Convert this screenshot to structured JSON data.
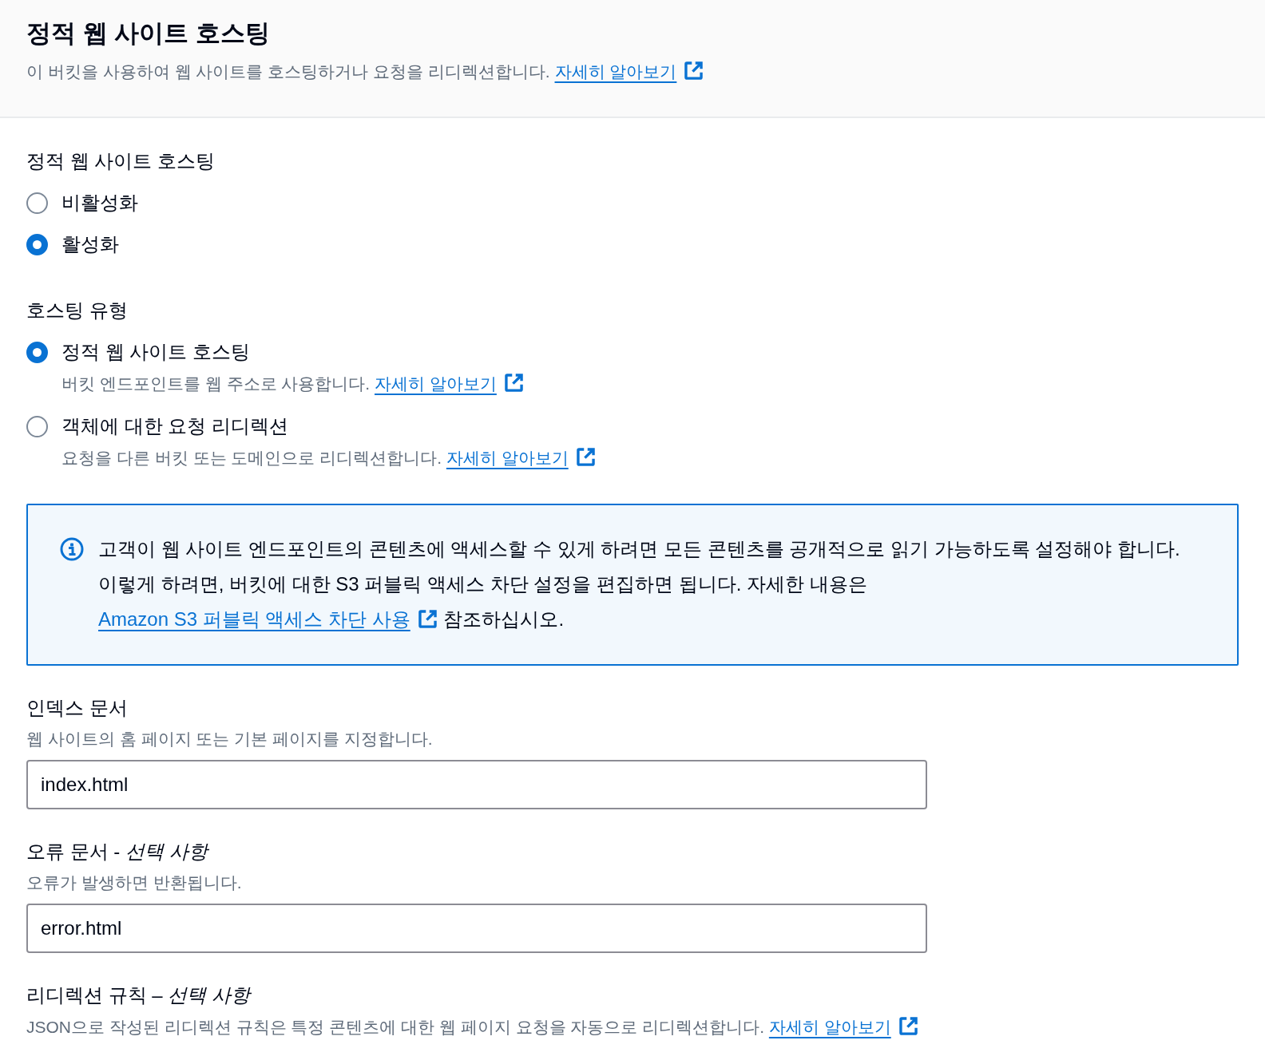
{
  "header": {
    "title": "정적 웹 사이트 호스팅",
    "description": "이 버킷을 사용하여 웹 사이트를 호스팅하거나 요청을 리디렉션합니다.",
    "link": "자세히 알아보기"
  },
  "hosting": {
    "label": "정적 웹 사이트 호스팅",
    "options": [
      {
        "label": "비활성화",
        "selected": false
      },
      {
        "label": "활성화",
        "selected": true
      }
    ]
  },
  "hosting_type": {
    "label": "호스팅 유형",
    "options": [
      {
        "label": "정적 웹 사이트 호스팅",
        "description": "버킷 엔드포인트를 웹 주소로 사용합니다.",
        "link": "자세히 알아보기",
        "selected": true
      },
      {
        "label": "객체에 대한 요청 리디렉션",
        "description": "요청을 다른 버킷 또는 도메인으로 리디렉션합니다.",
        "link": "자세히 알아보기",
        "selected": false
      }
    ]
  },
  "info_alert": {
    "text": "고객이 웹 사이트 엔드포인트의 콘텐츠에 액세스할 수 있게 하려면 모든 콘텐츠를 공개적으로 읽기 가능하도록 설정해야 합니다. 이렇게 하려면, 버킷에 대한 S3 퍼블릭 액세스 차단 설정을 편집하면 됩니다. 자세한 내용은",
    "link": "Amazon S3 퍼블릭 액세스 차단 사용",
    "text_after": "참조하십시오."
  },
  "fields": [
    {
      "label": "인덱스 문서",
      "description": "웹 사이트의 홈 페이지 또는 기본 페이지를 지정합니다.",
      "value": "index.html"
    },
    {
      "label": "오류 문서 - *선택 사항*",
      "description": "오류가 발생하면 반환됩니다.",
      "value": "error.html"
    }
  ],
  "redirect_rules": {
    "label": "리디렉션 규칙 – *선택 사항*",
    "description": "JSON으로 작성된 리디렉션 규칙은 특정 콘텐츠에 대한 웹 페이지 요청을 자동으로 리디렉션합니다.",
    "link": "자세히 알아보기"
  }
}
